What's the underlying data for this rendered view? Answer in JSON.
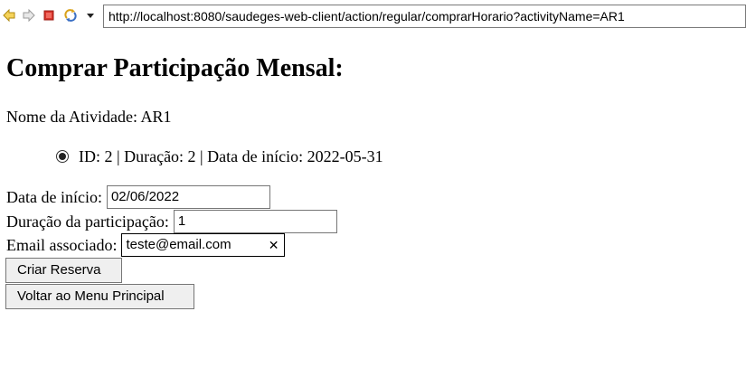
{
  "browser": {
    "url": "http://localhost:8080/saudeges-web-client/action/regular/comprarHorario?activityName=AR1",
    "icons": {
      "back": "back-arrow-icon",
      "forward": "forward-arrow-icon",
      "stop": "stop-icon",
      "refresh": "refresh-icon",
      "menu": "dropdown-arrow-icon"
    },
    "colors": {
      "back_arrow": "#f0c020",
      "stop": "#d9342b"
    }
  },
  "page": {
    "title": "Comprar Participação Mensal:",
    "activity_label": "Nome da Atividade:",
    "activity_name": "AR1",
    "schedule_option": {
      "text": "ID: 2 | Duração: 2 | Data de início: 2022-05-31",
      "selected": true
    },
    "form": {
      "start_date_label": "Data de início:",
      "start_date_value": "02/06/2022",
      "duration_label": "Duração da participação:",
      "duration_value": "1",
      "email_label": "Email associado:",
      "email_value": "teste@email.com",
      "clear_glyph": "✕"
    },
    "buttons": {
      "create_reservation": "Criar Reserva",
      "back_to_menu": "Voltar ao Menu Principal"
    }
  }
}
